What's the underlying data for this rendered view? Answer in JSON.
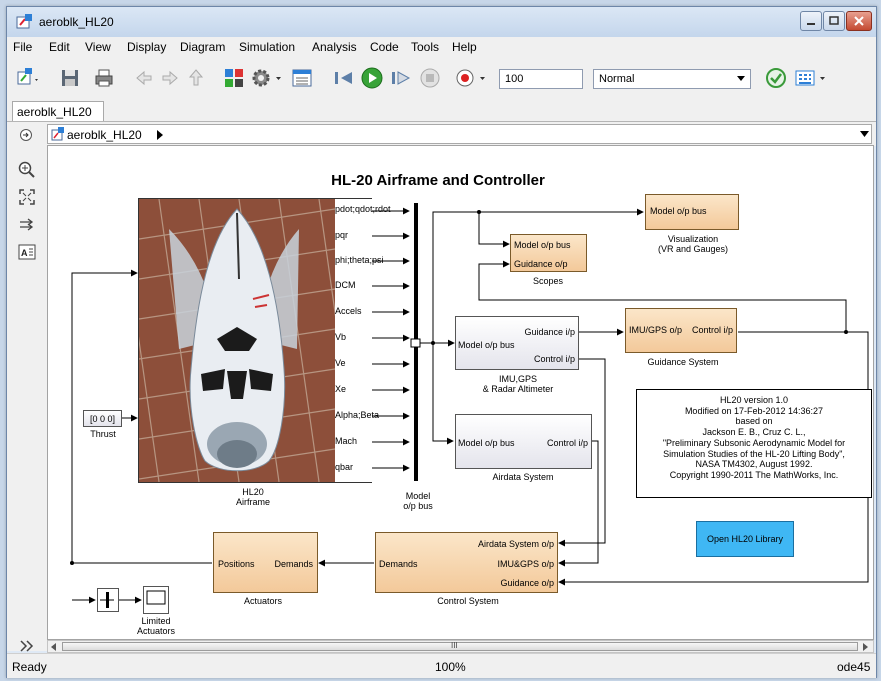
{
  "window": {
    "title": "aeroblk_HL20"
  },
  "menu": [
    "File",
    "Edit",
    "View",
    "Display",
    "Diagram",
    "Simulation",
    "Analysis",
    "Code",
    "Tools",
    "Help"
  ],
  "toolbar": {
    "stop_time": "100",
    "sim_mode": "Normal"
  },
  "tab": {
    "label": "aeroblk_HL20"
  },
  "breadcrumb": {
    "label": "aeroblk_HL20"
  },
  "diagram": {
    "title": "HL-20 Airframe and Controller",
    "airframe": {
      "caption_line1": "HL20",
      "caption_line2": "Airframe",
      "ports": [
        "pdot;qdot;rdot",
        "pqr",
        "phi;theta;psi",
        "DCM",
        "Accels",
        "Vb",
        "Ve",
        "Xe",
        "Alpha;Beta",
        "Mach",
        "qbar"
      ]
    },
    "bus": {
      "caption_line1": "Model",
      "caption_line2": "o/p bus"
    },
    "thrust": {
      "value": "[0 0 0]",
      "label": "Thrust"
    },
    "visualization": {
      "port": "Model o/p  bus",
      "caption_line1": "Visualization",
      "caption_line2": "(VR and Gauges)"
    },
    "scopes": {
      "port1": "Model o/p bus",
      "port2": "Guidance o/p",
      "caption": "Scopes"
    },
    "imu": {
      "in": "Model o/p bus",
      "out1": "Guidance i/p",
      "out2": "Control i/p",
      "caption_line1": "IMU,GPS",
      "caption_line2": "& Radar Altimeter"
    },
    "guidance": {
      "in": "IMU/GPS o/p",
      "out": "Control i/p",
      "caption": "Guidance System"
    },
    "airdata": {
      "in": "Model o/p bus",
      "out": "Control i/p",
      "caption": "Airdata System"
    },
    "info": [
      "HL20 version 1.0",
      "Modified on 17-Feb-2012 14:36:27",
      "based on",
      "Jackson E. B., Cruz C. L.,",
      "\"Preliminary Subsonic Aerodynamic Model for",
      "Simulation Studies of the HL-20 Lifting Body\",",
      "NASA TM4302, August 1992.",
      "Copyright 1990-2011 The MathWorks, Inc."
    ],
    "library_button": "Open HL20 Library",
    "control": {
      "in1": "Airdata System o/p",
      "in2": "IMU&GPS o/p",
      "in3": "Guidance o/p",
      "out": "Demands",
      "caption": "Control System"
    },
    "actuators": {
      "in": "Positions",
      "out": "Demands",
      "caption": "Actuators"
    },
    "limited": {
      "caption_line1": "Limited",
      "caption_line2": "Actuators"
    }
  },
  "scroll": {
    "center_marker": "III"
  },
  "status": {
    "left": "Ready",
    "zoom": "100%",
    "solver": "ode45"
  },
  "colors": {
    "block_orange": "#f3c99a",
    "library_button": "#3fb7f4",
    "window_frame": "#c4d6ec"
  }
}
